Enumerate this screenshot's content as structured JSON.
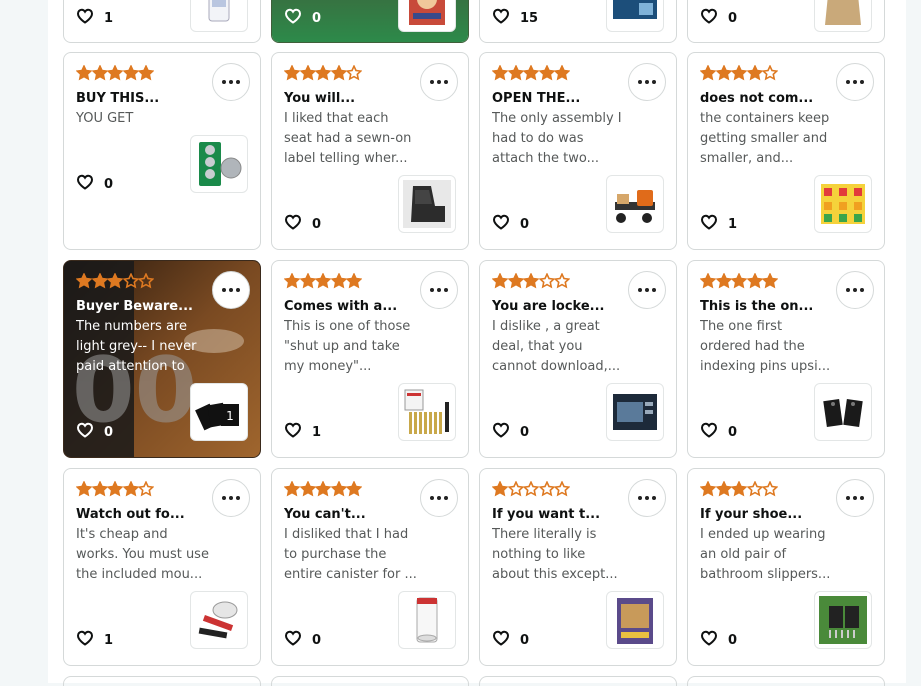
{
  "top_row": [
    {
      "likes": "1",
      "thumb": "pill-bottle"
    },
    {
      "likes": "0",
      "thumb": "book-cover",
      "variant": "photo"
    },
    {
      "likes": "15",
      "thumb": "battery-pack"
    },
    {
      "likes": "0",
      "thumb": "paper-bag"
    }
  ],
  "reviews": [
    {
      "rating": 5,
      "title": "BUY THIS...",
      "body": [
        "YOU GET"
      ],
      "likes": "0",
      "thumb": "coin-batteries"
    },
    {
      "rating": 4,
      "title": "You will...",
      "body": [
        "I liked that each",
        "seat had a sewn-on",
        "label telling wher..."
      ],
      "likes": "0",
      "thumb": "car-seat-cover"
    },
    {
      "rating": 5,
      "title": "OPEN THE...",
      "body": [
        "The only assembly I",
        "had to do was",
        "attach the two..."
      ],
      "likes": "0",
      "thumb": "log-splitter"
    },
    {
      "rating": 4,
      "title": "does not com...",
      "body": [
        "the containers keep",
        "getting smaller and",
        "smaller, and..."
      ],
      "likes": "1",
      "thumb": "play-dough-tubs"
    },
    {
      "rating": 3,
      "title": "Buyer Beware...",
      "body": [
        "The numbers are",
        "light grey-- I never",
        "paid attention to"
      ],
      "likes": "0",
      "thumb": "number-cards",
      "variant": "dark",
      "thumb_text": "1"
    },
    {
      "rating": 5,
      "title": "Comes with a...",
      "body": [
        "This is one of those",
        "\"shut up and take",
        "my money\"..."
      ],
      "likes": "1",
      "thumb": "screwdriver-set"
    },
    {
      "rating": 3,
      "title": "You are locke...",
      "body": [
        "I dislike , a great",
        "deal, that you",
        "cannot download,..."
      ],
      "likes": "0",
      "thumb": "software-box"
    },
    {
      "rating": 5,
      "title": "This is the on...",
      "body": [
        "The one first",
        "ordered had the",
        "indexing pins upsi..."
      ],
      "likes": "0",
      "thumb": "indexing-jig"
    },
    {
      "rating": 4,
      "title": "Watch out fo...",
      "body": [
        "It's cheap and",
        "works. You must use",
        "the included mou..."
      ],
      "likes": "1",
      "thumb": "pipe-tool"
    },
    {
      "rating": 5,
      "title": "You can't...",
      "body": [
        "I disliked that I had",
        "to purchase the",
        "entire canister for ..."
      ],
      "likes": "0",
      "thumb": "glass-canister"
    },
    {
      "rating": 1,
      "title": "If you want t...",
      "body": [
        "There literally is",
        "nothing to like",
        "about this except..."
      ],
      "likes": "0",
      "thumb": "dvd-cover"
    },
    {
      "rating": 3,
      "title": "If your shoe...",
      "body": [
        "I ended up wearing",
        "an old pair of",
        "bathroom slippers..."
      ],
      "likes": "0",
      "thumb": "lawn-aerator-shoes"
    }
  ],
  "colors": {
    "star": "#de7921",
    "border": "#d5d9d9",
    "text": "#0f1111",
    "muted": "#565959"
  }
}
